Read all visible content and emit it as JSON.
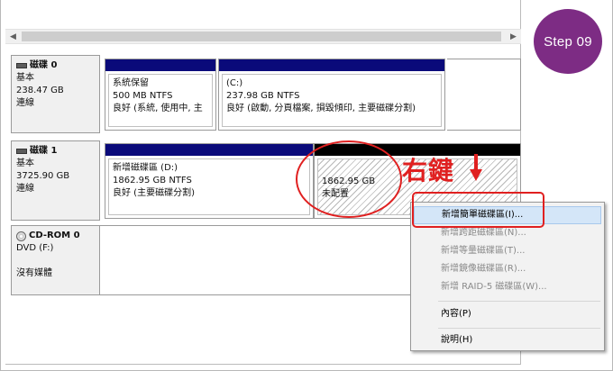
{
  "step_badge": "Step 09",
  "scrollbar": {
    "left_arrow": "◀",
    "right_arrow": "▶"
  },
  "disks": [
    {
      "name": "磁碟 0",
      "type": "基本",
      "size": "238.47 GB",
      "status": "連線",
      "partitions": [
        {
          "name": "系統保留",
          "size": "500 MB NTFS",
          "status": "良好 (系統, 使用中, 主"
        },
        {
          "name": "(C:)",
          "size": "237.98 GB NTFS",
          "status": "良好 (啟動, 分頁檔案, 損毀傾印, 主要磁碟分割)"
        }
      ]
    },
    {
      "name": "磁碟 1",
      "type": "基本",
      "size": "3725.90 GB",
      "status": "連線",
      "partitions": [
        {
          "name": "新增磁碟區 (D:)",
          "size": "1862.95 GB NTFS",
          "status": "良好 (主要磁碟分割)"
        },
        {
          "name": "",
          "size": "1862.95 GB",
          "status": "未配置"
        }
      ]
    },
    {
      "name": "CD-ROM 0",
      "type": "DVD (F:)",
      "size": "",
      "status": "沒有媒體"
    }
  ],
  "annotation": {
    "text": "右鍵"
  },
  "context_menu": {
    "items": [
      {
        "label": "新增簡單磁碟區(I)...",
        "enabled": true
      },
      {
        "label": "新增跨距磁碟區(N)...",
        "enabled": false
      },
      {
        "label": "新增等量磁碟區(T)...",
        "enabled": false
      },
      {
        "label": "新增鏡像磁碟區(R)...",
        "enabled": false
      },
      {
        "label": "新增 RAID-5 磁碟區(W)...",
        "enabled": false
      },
      {
        "label": "內容(P)",
        "enabled": true
      },
      {
        "label": "說明(H)",
        "enabled": true
      }
    ]
  },
  "colors": {
    "primary_bar": "#0a0a7a",
    "unallocated_bar": "#000000",
    "annotation_red": "#e02020",
    "badge_purple": "#7d2c84",
    "menu_highlight": "#d4e6f8"
  }
}
